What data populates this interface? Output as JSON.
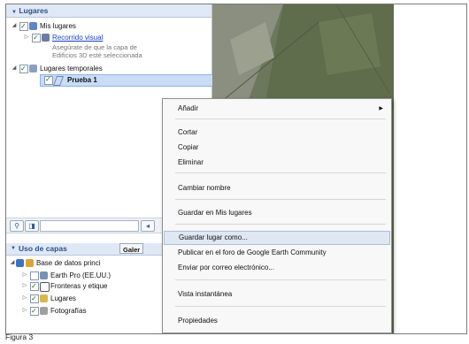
{
  "places_panel": {
    "title": "Lugares",
    "items": [
      {
        "label": "Mis lugares"
      },
      {
        "label": "Recorrido visual"
      },
      {
        "label": "Lugares temporales"
      },
      {
        "label": "Prueba 1"
      }
    ],
    "note_line1": "Asegúrate de que la capa de",
    "note_line2": "Edificios 3D esté seleccionada"
  },
  "layers_panel": {
    "title": "Uso de capas",
    "tab_label": "Galer",
    "items": [
      {
        "label": "Base de datos princi"
      },
      {
        "label": "Earth Pro (EE.UU.)"
      },
      {
        "label": "Fronteras y etique"
      },
      {
        "label": "Lugares"
      },
      {
        "label": "Fotografías"
      }
    ]
  },
  "context_menu": {
    "items": [
      {
        "label": "Añadir"
      },
      {
        "label": "Cortar"
      },
      {
        "label": "Copiar"
      },
      {
        "label": "Eliminar"
      },
      {
        "label": "Cambiar nombre"
      },
      {
        "label": "Guardar en Mis lugares"
      },
      {
        "label": "Guardar lugar como..."
      },
      {
        "label": "Publicar en el foro de Google Earth Community"
      },
      {
        "label": "Enviar por correo electrónico..."
      },
      {
        "label": "Vista instantánea"
      },
      {
        "label": "Propiedades"
      }
    ]
  },
  "caption": "Figura 3"
}
